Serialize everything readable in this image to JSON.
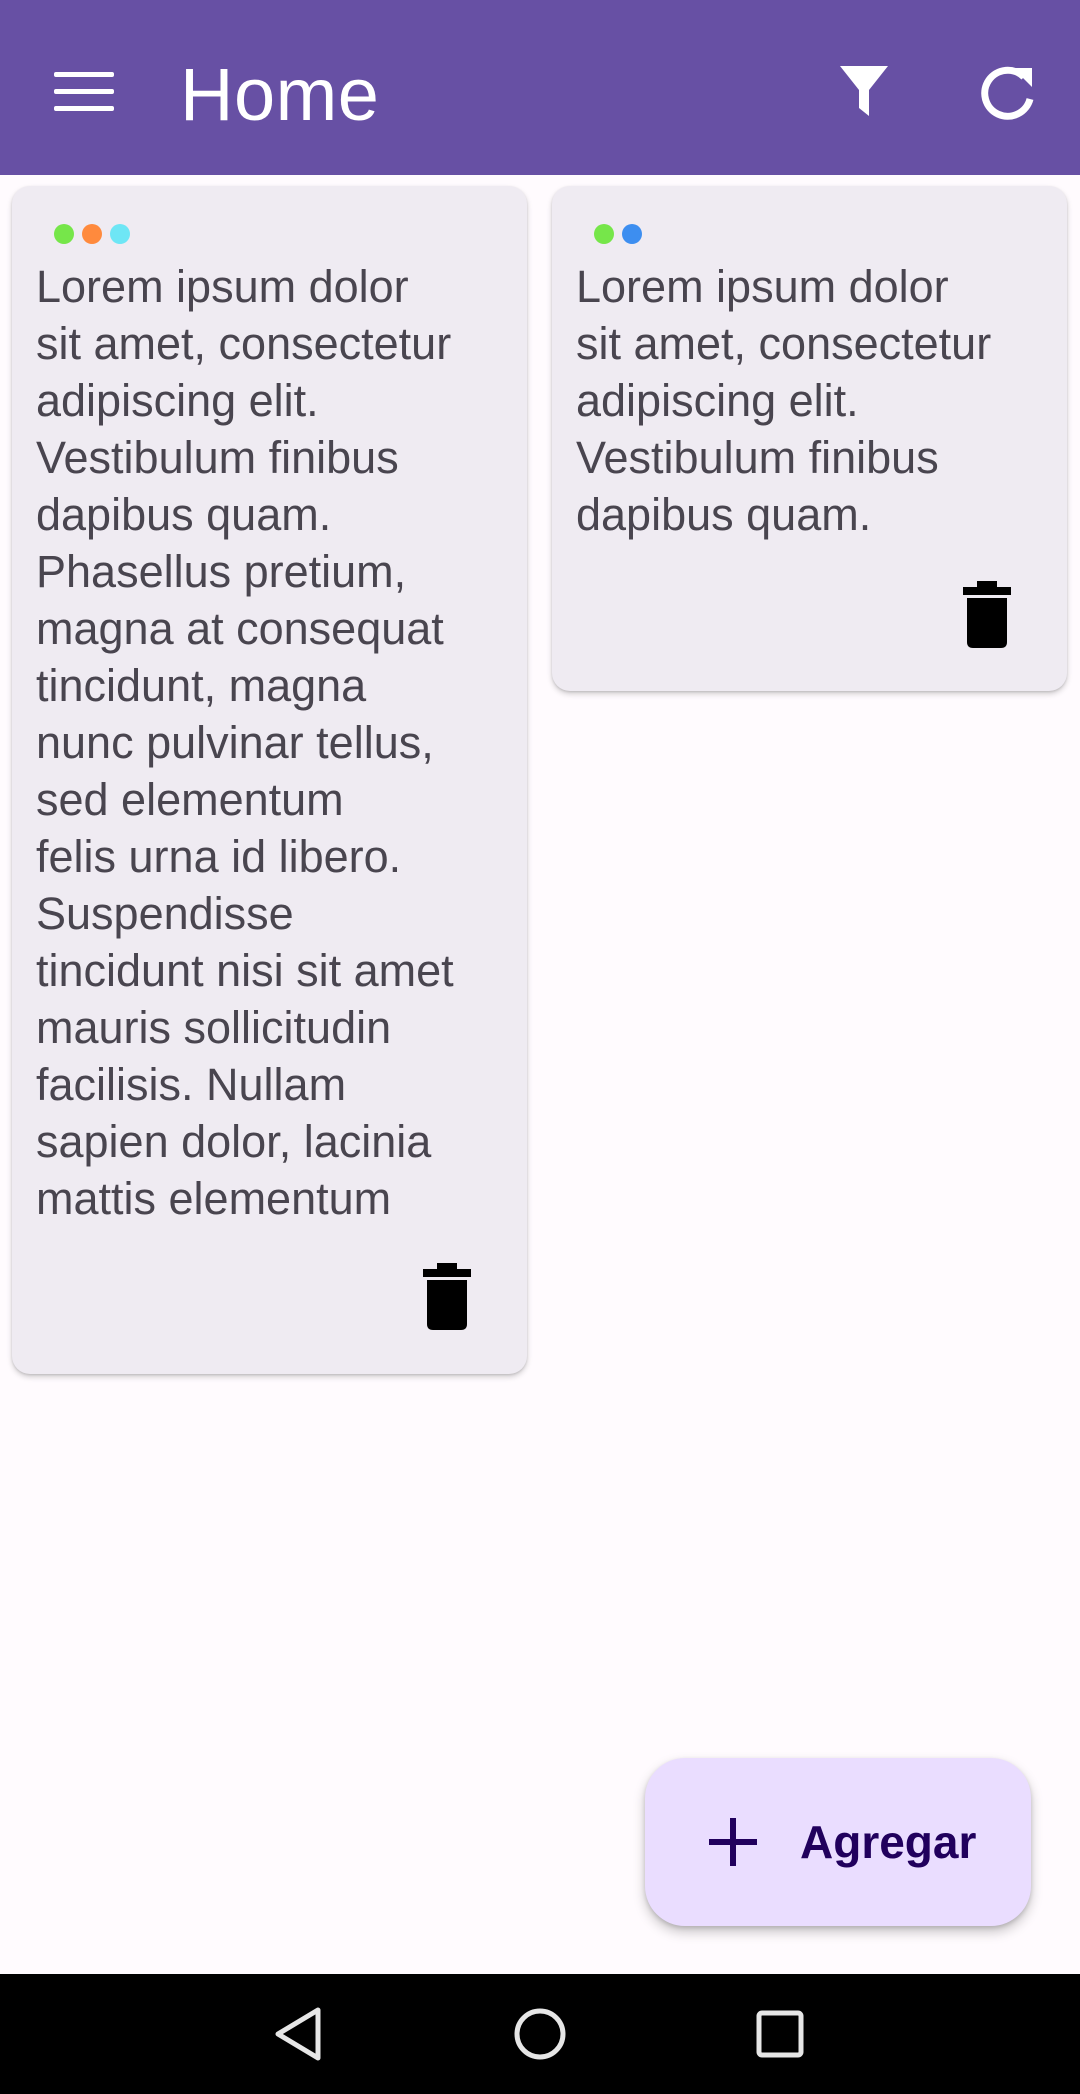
{
  "app_bar": {
    "title": "Home",
    "background": "#6750a4",
    "icons": {
      "menu": "menu-icon",
      "filter": "filter-icon",
      "refresh": "refresh-icon"
    }
  },
  "notes": [
    {
      "color_tags": [
        "#76e64a",
        "#ff8a3d",
        "#6ee6f5"
      ],
      "text": "Lorem ipsum dolor\nsit amet, consectetur\nadipiscing elit.\nVestibulum finibus\ndapibus quam.\nPhasellus pretium,\nmagna at consequat\ntincidunt, magna\nnunc pulvinar tellus,\nsed elementum\nfelis urna id libero.\nSuspendisse\ntincidunt nisi sit amet\nmauris sollicitudin\nfacilisis. Nullam\nsapien dolor, lacinia\nmattis elementum",
      "delete_icon": "trash-icon"
    },
    {
      "color_tags": [
        "#76e64a",
        "#3d8ef0"
      ],
      "text": "Lorem ipsum dolor\nsit amet, consectetur\nadipiscing elit.\nVestibulum finibus\ndapibus quam.",
      "delete_icon": "trash-icon"
    }
  ],
  "fab": {
    "label": "Agregar",
    "icon": "plus-icon",
    "background": "#eaddff"
  },
  "nav_bar": {
    "icons": [
      "back-icon",
      "home-icon",
      "recents-icon"
    ]
  }
}
